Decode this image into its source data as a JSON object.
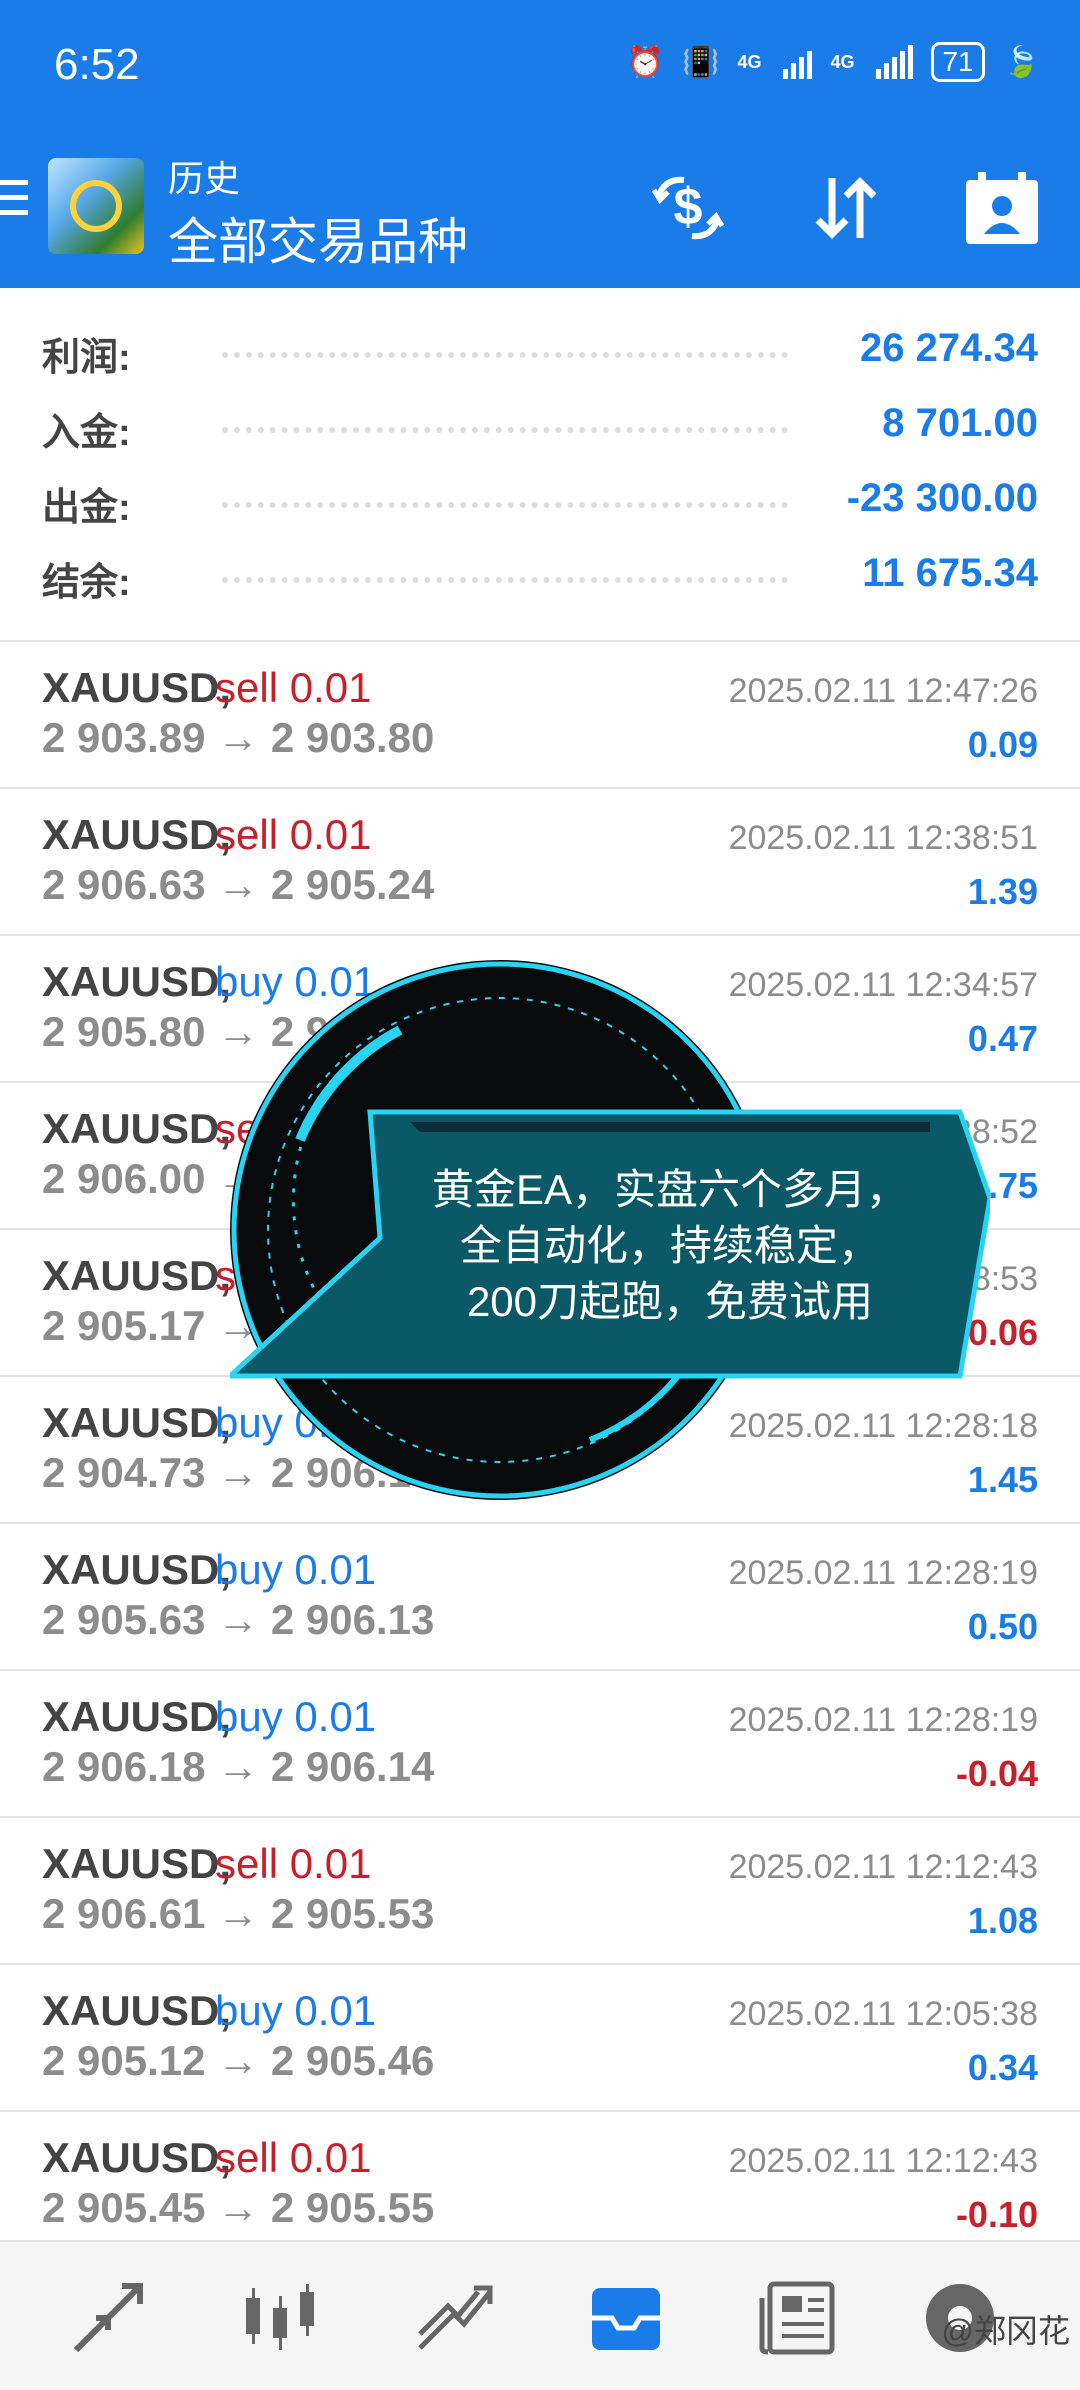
{
  "status_bar": {
    "time": "6:52",
    "network1": "4G",
    "network2": "4G",
    "battery": "71"
  },
  "header": {
    "subtitle": "历史",
    "title": "全部交易品种"
  },
  "summary": [
    {
      "label": "利润:",
      "value": "26 274.34"
    },
    {
      "label": "入金:",
      "value": "8 701.00"
    },
    {
      "label": "出金:",
      "value": "-23 300.00"
    },
    {
      "label": "结余:",
      "value": "11 675.34"
    }
  ],
  "trades": [
    {
      "symbol": "XAUUSD,",
      "side": "sell 0.01",
      "prices": "2 903.89 → 2 903.80",
      "time": "2025.02.11 12:47:26",
      "profit": "0.09"
    },
    {
      "symbol": "XAUUSD,",
      "side": "sell 0.01",
      "prices": "2 906.63 → 2 905.24",
      "time": "2025.02.11 12:38:51",
      "profit": "1.39"
    },
    {
      "symbol": "XAUUSD,",
      "side": "buy 0.01",
      "prices": "2 905.80 → 2 9",
      "time": "2025.02.11 12:34:57",
      "profit": "0.47"
    },
    {
      "symbol": "XAUUSD,",
      "side": "sel",
      "prices": "2 906.00 →",
      "time": "38:52",
      "profit": "0.75"
    },
    {
      "symbol": "XAUUSD,",
      "side": "se",
      "prices": "2 905.17 →",
      "time": "38:53",
      "profit": "-0.06"
    },
    {
      "symbol": "XAUUSD,",
      "side": "buy 0.0",
      "prices": "2 904.73 → 2 906.18",
      "time": "2025.02.11 12:28:18",
      "profit": "1.45"
    },
    {
      "symbol": "XAUUSD,",
      "side": "buy 0.01",
      "prices": "2 905.63 → 2 906.13",
      "time": "2025.02.11 12:28:19",
      "profit": "0.50"
    },
    {
      "symbol": "XAUUSD,",
      "side": "buy 0.01",
      "prices": "2 906.18 → 2 906.14",
      "time": "2025.02.11 12:28:19",
      "profit": "-0.04"
    },
    {
      "symbol": "XAUUSD,",
      "side": "sell 0.01",
      "prices": "2 906.61 → 2 905.53",
      "time": "2025.02.11 12:12:43",
      "profit": "1.08"
    },
    {
      "symbol": "XAUUSD,",
      "side": "buy 0.01",
      "prices": "2 905.12 → 2 905.46",
      "time": "2025.02.11 12:05:38",
      "profit": "0.34"
    },
    {
      "symbol": "XAUUSD,",
      "side": "sell 0.01",
      "prices": "2 905.45 → 2 905.55",
      "time": "2025.02.11 12:12:43",
      "profit": "-0.10"
    }
  ],
  "ad": {
    "line1": "黄金EA，实盘六个多月，",
    "line2": "全自动化，持续稳定，",
    "line3": "200刀起跑，免费试用"
  },
  "watermark": "@郑冈花",
  "colors": {
    "brand": "#1a7ce8",
    "negative": "#c8202a",
    "muted": "#8c8c8c",
    "ad_panel": "#0b5866",
    "ad_glow": "#28d4f4"
  },
  "icons": {
    "header": [
      "menu-icon",
      "app-logo-icon",
      "currency-exchange-icon",
      "sort-icon",
      "calendar-icon"
    ],
    "bottom_nav": [
      "quotes-icon",
      "chart-icon",
      "trade-icon",
      "history-icon",
      "news-icon",
      "settings-icon"
    ]
  }
}
